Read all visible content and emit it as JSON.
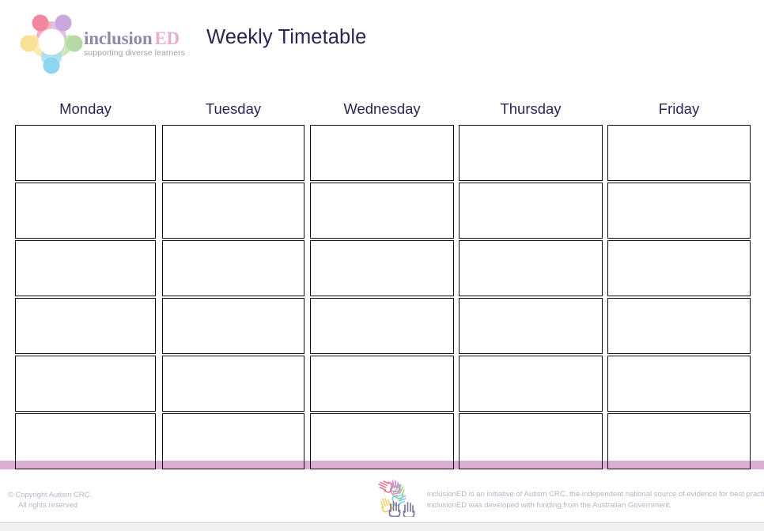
{
  "header": {
    "logo_icon": "inclusioned-circle-people-logo",
    "wordmark_part1": "inclusion",
    "wordmark_part2": "ED",
    "tagline": "supporting diverse learners",
    "title": "Weekly Timetable"
  },
  "timetable": {
    "days": [
      "Monday",
      "Tuesday",
      "Wednesday",
      "Thursday",
      "Friday"
    ],
    "row_count": 6,
    "cells": [
      [
        "",
        "",
        "",
        "",
        ""
      ],
      [
        "",
        "",
        "",
        "",
        ""
      ],
      [
        "",
        "",
        "",
        "",
        ""
      ],
      [
        "",
        "",
        "",
        "",
        ""
      ],
      [
        "",
        "",
        "",
        "",
        ""
      ],
      [
        "",
        "",
        "",
        "",
        ""
      ]
    ]
  },
  "footer": {
    "copyright_line1": "© Copyright Autism CRC.",
    "copyright_line2": "All rights reserved",
    "hands_icon": "colored-hands-star-icon",
    "note_line1": "inclusionED is an initiative of Autism CRC, the independent national source of evidence for best practice.",
    "note_line2": "inclusionED was developed with funding from the Australian Government."
  },
  "colors": {
    "accent_band": "#ddaed4",
    "title_text": "#2b2552",
    "wordmark_inclusion": "#8f8aa8",
    "wordmark_ed": "#e7afce",
    "footer_text": "#b6b4c6",
    "cell_border": "#111111",
    "logo_pink": "#f2899f",
    "logo_purple": "#c9a8dc",
    "logo_green": "#b5dba4",
    "logo_blue": "#8fd5ef",
    "logo_yellow": "#fae094",
    "logo_salmon": "#f4a7ae"
  }
}
